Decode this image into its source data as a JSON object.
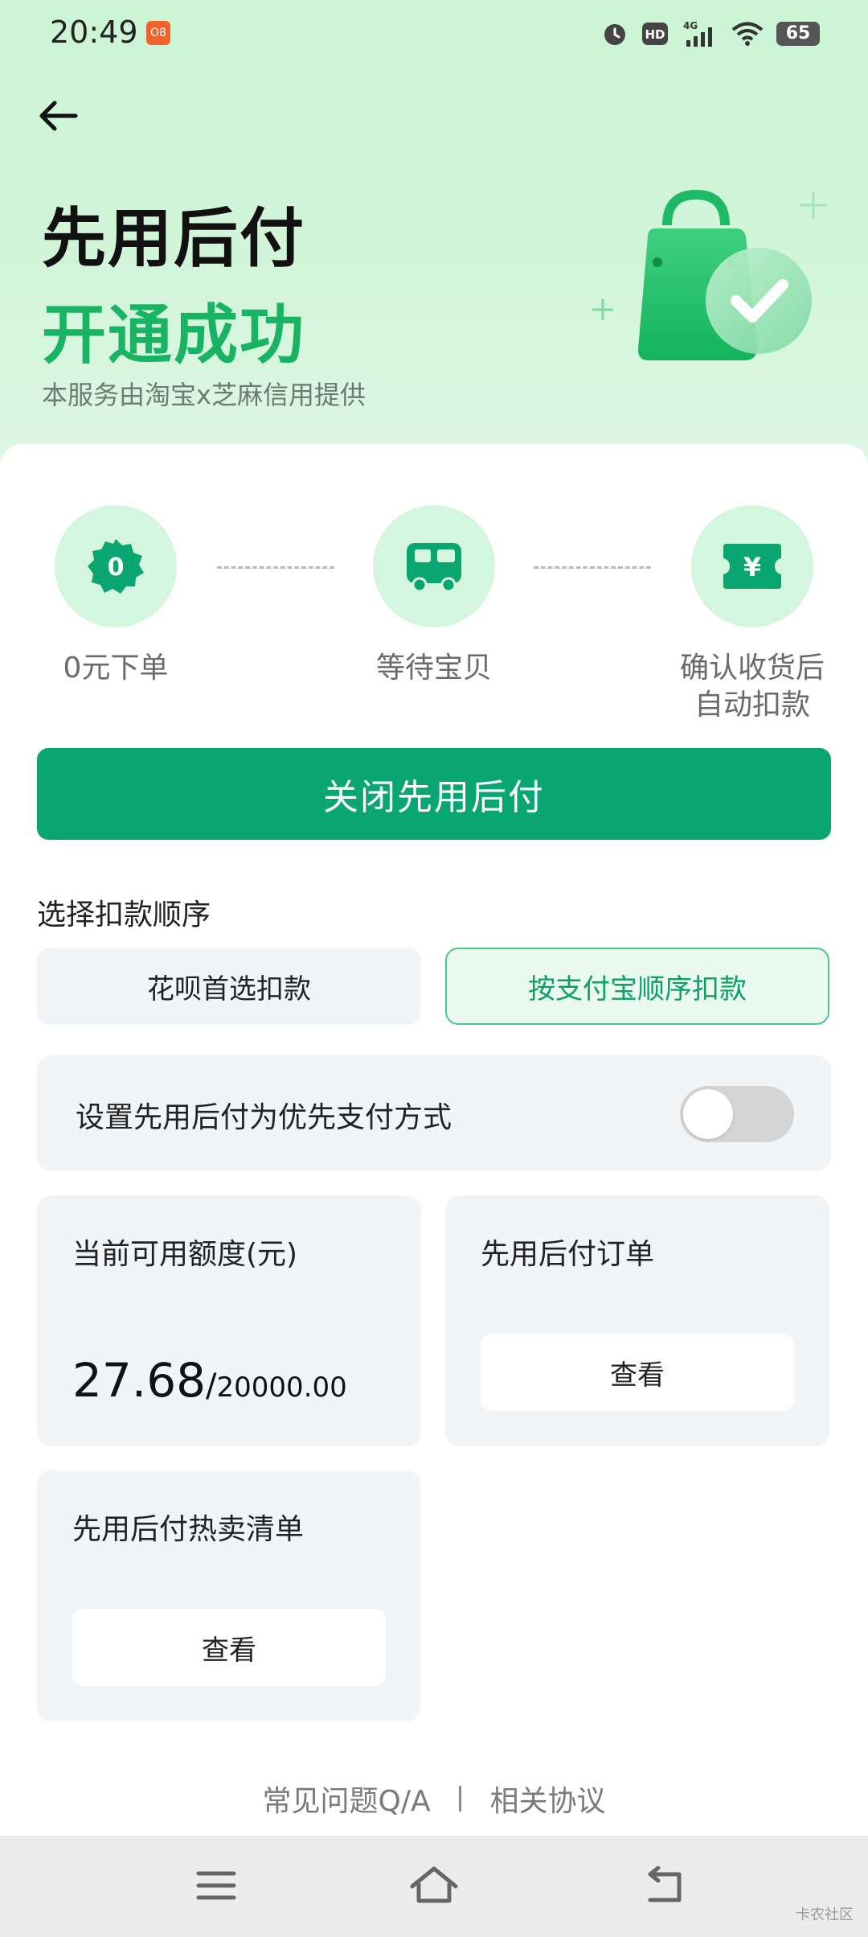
{
  "status_bar": {
    "time": "20:49",
    "notif_badge": "O8",
    "network": "4G",
    "hd": "HD",
    "battery": "65"
  },
  "header": {
    "title_line1": "先用后付",
    "title_line2": "开通成功",
    "subtitle": "本服务由淘宝x芝麻信用提供"
  },
  "steps": [
    {
      "label": "0元下单",
      "icon_text": "0",
      "icon": "badge-zero-icon"
    },
    {
      "label": "等待宝贝",
      "icon": "truck-icon"
    },
    {
      "label_line1": "确认收货后",
      "label_line2": "自动扣款",
      "icon_text": "¥",
      "icon": "yen-ticket-icon"
    }
  ],
  "close_button": "关闭先用后付",
  "deduction": {
    "title": "选择扣款顺序",
    "options": [
      "花呗首选扣款",
      "按支付宝顺序扣款"
    ],
    "selected_index": 1
  },
  "preferred_payment": {
    "label": "设置先用后付为优先支付方式",
    "enabled": false
  },
  "credit": {
    "title": "当前可用额度(元)",
    "available": "27.68",
    "slash": "/",
    "total": "20000.00"
  },
  "orders": {
    "title": "先用后付订单",
    "button": "查看"
  },
  "hot_list": {
    "title": "先用后付热卖清单",
    "button": "查看"
  },
  "footer": {
    "faq": "常见问题Q/A",
    "agreement": "相关协议"
  },
  "watermark": "卡农社区",
  "colors": {
    "brand_green": "#0aa671",
    "title_green": "#18b363",
    "hero_bg": "#cdf4d6"
  }
}
